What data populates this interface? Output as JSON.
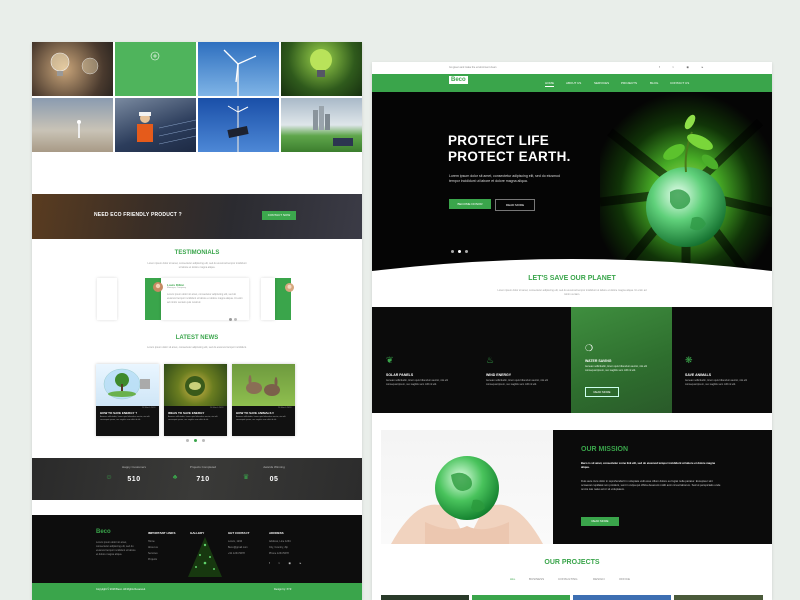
{
  "left": {
    "banner": {
      "text": "NEED ECO FRIENDLY PRODUCT ?",
      "button": "CONTACT NOW"
    },
    "testimonials": {
      "title": "TESTIMONIALS",
      "intro": "Lorem ipsum dolor sit amet, consectetur adipiscing elit, sed do eiusmod tempor incididunt ut labore et dolore magna aliqua.",
      "name": "Louis Dillon",
      "role": "Manager, Company",
      "quote": "Lorem ipsum dolor sit amet, consectetur adipiscing elit, sed do eiusmod tempor incididunt ut labore et dolore magna aliqua. Ut enim ad minim veniam quis nostrud."
    },
    "news": {
      "title": "LATEST NEWS",
      "intro": "Lorem ipsum dolor sit amet, consectetur adipiscing elit, sed do eiusmod tempor incididunt.",
      "items": [
        {
          "title": "HOW TO SAVE ENERGY ?",
          "date": "26 March 2018",
          "text": "Aenean sollicitudin, lorem quis bibendum auctor, nisi elit consequat ipsum, nec sagittis sem nibh id elit."
        },
        {
          "title": "IDEAS TO SAVE ENERGY",
          "date": "26 March 2018",
          "text": "Aenean sollicitudin, lorem quis bibendum auctor, nisi elit consequat ipsum, nec sagittis sem nibh id elit."
        },
        {
          "title": "HOW TO SAVE ANIMALS !!",
          "date": "26 March 2018",
          "text": "Aenean sollicitudin, lorem quis bibendum auctor, nisi elit consequat ipsum, nec sagittis sem nibh id elit."
        }
      ]
    },
    "stats": [
      {
        "label": "Happy Customers",
        "value": "510",
        "icon": "smile-icon"
      },
      {
        "label": "Projects Completed",
        "value": "710",
        "icon": "tree-icon"
      },
      {
        "label": "Awards Winning",
        "value": "05",
        "icon": "trophy-icon"
      }
    ],
    "footer": {
      "logo": "Beco",
      "about": "Lorem ipsum dolor sit amet, consectetur adipiscing elit, sed do eiusmod tempor incididunt ut labore et dolore magna aliqua.",
      "col1_title": "IMPORTANT LINKS",
      "col1_links": [
        "Home",
        "About us",
        "Services",
        "Projects"
      ],
      "col2_title": "GALLERY",
      "col3_title": "GET CONTACT",
      "col3_lines": [
        "Lorem, 1234",
        "Beco@gmail.com",
        "+91 1234 5678"
      ],
      "col4_title": "ADDRESS",
      "col4_lines": [
        "Address, Line 1234",
        "City, Country, Zip",
        "Phone 1234 5678"
      ],
      "copyright": "Copyright © 2018 Beco. All Rights Reserved.",
      "credit": "Design by: XYZ"
    }
  },
  "right": {
    "topbar_text": "Go green and make the environment clean",
    "logo": "Beco",
    "nav": [
      "HOME",
      "ABOUT US",
      "SERVICES",
      "PROJECTS",
      "BLOG",
      "CONTACT US"
    ],
    "hero": {
      "line1": "PROTECT LIFE",
      "line2": "PROTECT EARTH.",
      "text": "Lorem ipsum dolor sit amet, consectetur adipiscing elit, sed do eiusmod tempor incididunt ut labore et dolore magna aliqua.",
      "btn1": "BECOME DONOR",
      "btn2": "READ MORE"
    },
    "save": {
      "title": "LET'S SAVE OUR PLANET",
      "text": "Lorem ipsum dolor sit amet, consectetur adipiscing elit, sed do eiusmod tempor incididunt ut labore et dolore magna aliqua. Ut enim ad minim veniam."
    },
    "features": [
      {
        "title": "SOLAR PANELS",
        "icon": "leaf-icon",
        "text": "Aenean sollicitudin, lorem quis bibendum auctor, nisi elit consequat ipsum, nec sagittis sem nibh id elit."
      },
      {
        "title": "WIND ENERGY",
        "icon": "bulb-icon",
        "text": "Aenean sollicitudin, lorem quis bibendum auctor, nisi elit consequat ipsum, nec sagittis sem nibh id elit."
      },
      {
        "title": "WATER SAVING",
        "icon": "drop-icon",
        "text": "Aenean sollicitudin, lorem quis bibendum auctor, nisi elit consequat ipsum, nec sagittis sem nibh id elit.",
        "button": "READ MORE"
      },
      {
        "title": "SAVE ANIMALS",
        "icon": "paw-icon",
        "text": "Aenean sollicitudin, lorem quis bibendum auctor, nisi elit consequat ipsum, nec sagittis sem nibh id elit."
      }
    ],
    "mission": {
      "title": "OUR MISSION",
      "lead": "Beco is sit amet, consectetur come link elit, sed do eiusmod tempor incididunt ut labore et dolore magna aliqua.",
      "body": "Duis aute irure dolor in reprehenderit in voluptate velit esse cillum dolore eu fugiat nulla pariatur. Excepteur sint occaecat cupidatat non proident, sunt in culpa qui officia deserunt mollit anim id est laborum. Sed ut perspiciatis unde omnis iste natus error sit voluptatem.",
      "button": "READ MORE"
    },
    "projects": {
      "title": "OUR PROJECTS",
      "tabs": [
        "ALL",
        "BUSINESS",
        "CONSULTING",
        "DESIGN",
        "OFFICE"
      ]
    }
  },
  "colors": {
    "accent": "#3aa54b",
    "dark": "#0b0b0b"
  }
}
